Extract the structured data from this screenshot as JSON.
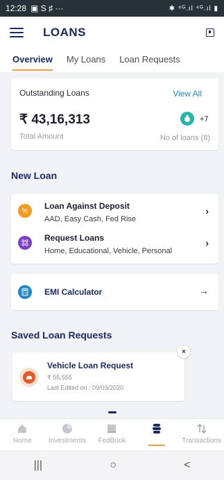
{
  "status_bar": {
    "time": "12:28",
    "left_icons": "▣ S ♯ ···",
    "right_icons": "✱ ⁴ᴳ.ıl ⁴ᴳ.ıl ▮"
  },
  "header": {
    "title": "LOANS"
  },
  "tabs": [
    {
      "label": "Overview",
      "active": true
    },
    {
      "label": "My Loans",
      "active": false
    },
    {
      "label": "Loan Requests",
      "active": false
    }
  ],
  "outstanding": {
    "title": "Outstanding Loans",
    "view_all": "View All",
    "amount": "₹ 43,16,313",
    "amount_label": "Total Amount",
    "extra_count": "+7",
    "no_of_loans": "No of loans (8)"
  },
  "new_loan": {
    "section_title": "New Loan",
    "items": [
      {
        "title": "Loan Against Deposit",
        "subtitle": "AAD, Easy Cash, Fed Rise",
        "icon": "percent-icon",
        "color": "#f39a1e"
      },
      {
        "title": "Request Loans",
        "subtitle": "Home, Educational, Vehicle, Personal",
        "icon": "grid-icon",
        "color": "#7b3fc9"
      }
    ]
  },
  "emi": {
    "label": "EMI Calculator",
    "icon": "calculator-icon"
  },
  "saved": {
    "section_title": "Saved Loan Requests",
    "items": [
      {
        "title": "Vehicle Loan Request",
        "amount": "₹ 55,555",
        "last_edited": "Last Edited on : 09/03/2020",
        "icon": "car-icon"
      }
    ]
  },
  "bottom_nav": [
    {
      "label": "Home",
      "icon": "home-icon",
      "active": false
    },
    {
      "label": "Investments",
      "icon": "investments-icon",
      "active": false
    },
    {
      "label": "FedBook",
      "icon": "book-icon",
      "active": false
    },
    {
      "label": "",
      "icon": "loans-stack-icon",
      "active": true
    },
    {
      "label": "Transactions",
      "icon": "transfer-icon",
      "active": false
    }
  ],
  "android_nav": {
    "recents": "|||",
    "home": "○",
    "back": "<"
  },
  "colors": {
    "brand": "#1b2a6b",
    "accent": "#f0a030",
    "link": "#1e88c9"
  }
}
